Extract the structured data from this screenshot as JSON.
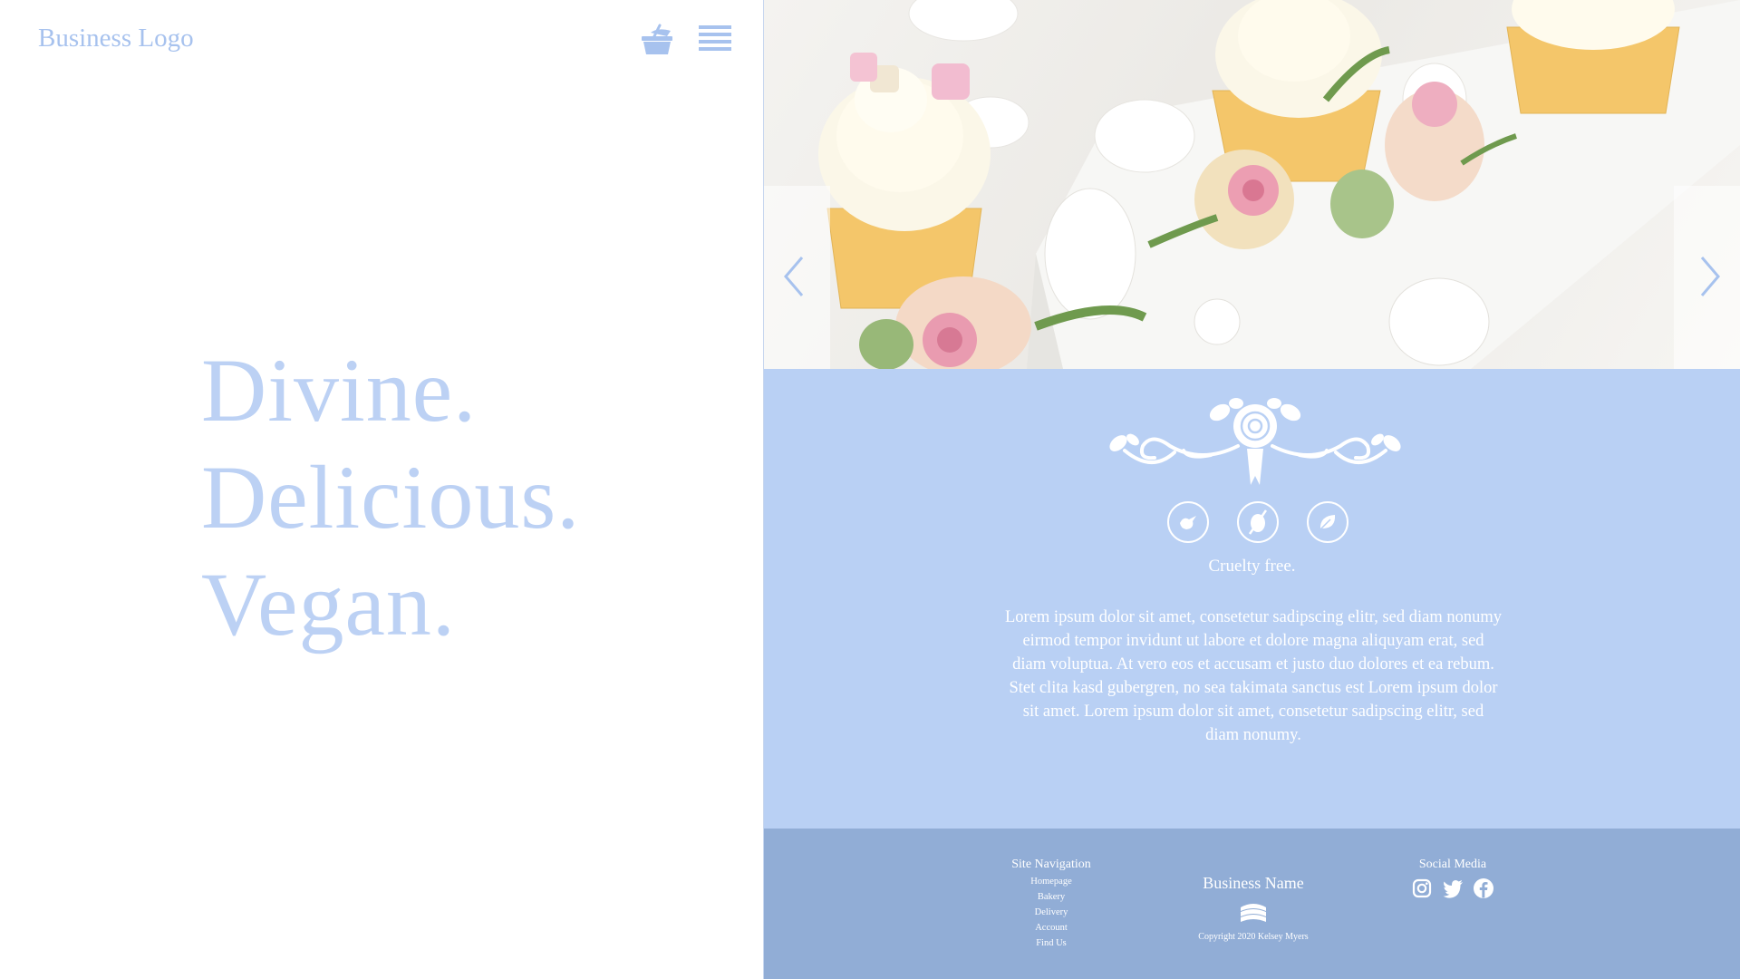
{
  "header": {
    "logo_text": "Business Logo",
    "basket_icon": "basket-icon",
    "menu_icon": "hamburger-menu-icon"
  },
  "hero": {
    "line1": "Divine.",
    "line2": "Delicious.",
    "line3": "Vegan."
  },
  "slider": {
    "image": "cupcakes-marshmallows-roses-photo",
    "prev_icon": "chevron-left-icon",
    "next_icon": "chevron-right-icon"
  },
  "content": {
    "ornament": "rose-flourish-ornament",
    "badges": [
      "bird-icon",
      "no-animal-icon",
      "leaf-icon"
    ],
    "tagline": "Cruelty free.",
    "body": "Lorem ipsum dolor sit amet, consetetur sadipscing elitr, sed diam nonumy eirmod tempor invidunt ut labore et dolore magna aliquyam erat, sed diam voluptua. At vero eos et accusam et justo duo dolores et ea rebum. Stet clita kasd gubergren, no sea takimata sanctus est Lorem ipsum dolor sit amet. Lorem ipsum dolor sit amet, consetetur sadipscing elitr, sed diam nonumy."
  },
  "footer": {
    "nav_title": "Site Navigation",
    "nav_items": [
      "Homepage",
      "Bakery",
      "Delivery",
      "Account",
      "Find Us"
    ],
    "business_name": "Business Name",
    "copyright": "Copyright 2020 Kelsey Myers",
    "social_title": "Social Media",
    "social_icons": [
      "instagram-icon",
      "twitter-icon",
      "facebook-icon"
    ]
  },
  "colors": {
    "accent_light": "#bcd1f4",
    "accent": "#a7c2ee",
    "content_bg": "#b9d0f4",
    "footer_bg": "#91add6"
  }
}
